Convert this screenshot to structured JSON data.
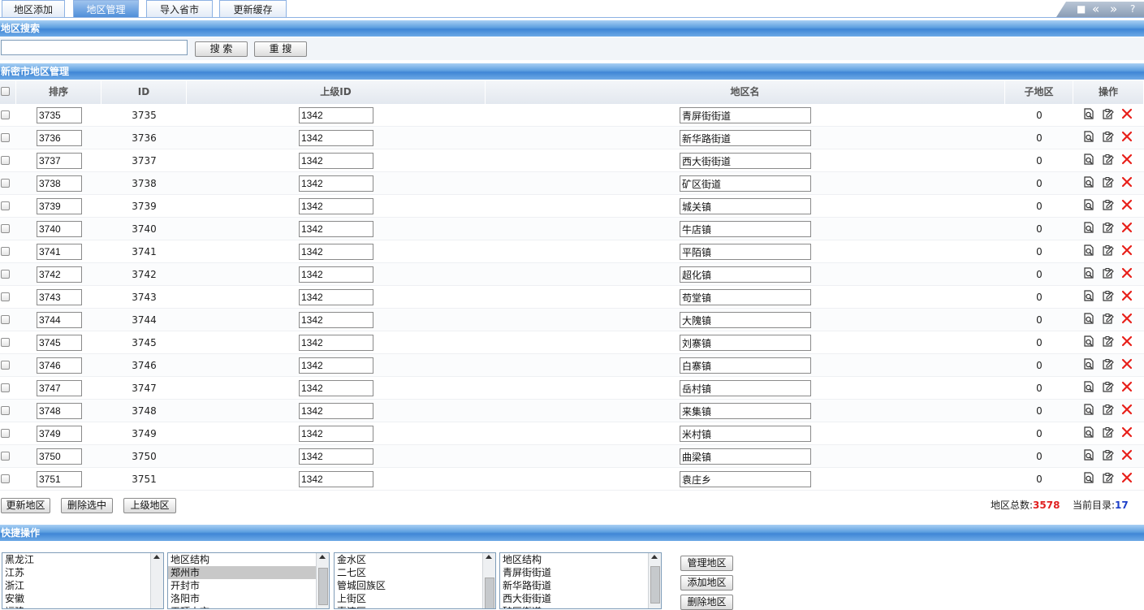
{
  "tabs": [
    {
      "label": "地区添加",
      "active": false
    },
    {
      "label": "地区管理",
      "active": true
    },
    {
      "label": "导入省市",
      "active": false
    },
    {
      "label": "更新缓存",
      "active": false
    }
  ],
  "top_controls": {
    "icons": [
      "sidebar-toggle-icon",
      "double-left-icon",
      "double-right-icon",
      "help-icon"
    ],
    "labels": [
      "■",
      "«",
      "»",
      "?"
    ]
  },
  "search": {
    "header": "地区搜索",
    "input_value": "",
    "search_label": "搜 索",
    "reset_label": "重 搜"
  },
  "manage": {
    "header": "新密市地区管理",
    "columns": {
      "order": "排序",
      "id": "ID",
      "parent_id": "上级ID",
      "name": "地区名",
      "children": "子地区",
      "actions": "操作"
    },
    "rows": [
      {
        "order": "3735",
        "id": "3735",
        "parent": "1342",
        "name": "青屏街街道",
        "children": "0"
      },
      {
        "order": "3736",
        "id": "3736",
        "parent": "1342",
        "name": "新华路街道",
        "children": "0"
      },
      {
        "order": "3737",
        "id": "3737",
        "parent": "1342",
        "name": "西大街街道",
        "children": "0"
      },
      {
        "order": "3738",
        "id": "3738",
        "parent": "1342",
        "name": "矿区街道",
        "children": "0"
      },
      {
        "order": "3739",
        "id": "3739",
        "parent": "1342",
        "name": "城关镇",
        "children": "0"
      },
      {
        "order": "3740",
        "id": "3740",
        "parent": "1342",
        "name": "牛店镇",
        "children": "0"
      },
      {
        "order": "3741",
        "id": "3741",
        "parent": "1342",
        "name": "平陌镇",
        "children": "0"
      },
      {
        "order": "3742",
        "id": "3742",
        "parent": "1342",
        "name": "超化镇",
        "children": "0"
      },
      {
        "order": "3743",
        "id": "3743",
        "parent": "1342",
        "name": "苟堂镇",
        "children": "0"
      },
      {
        "order": "3744",
        "id": "3744",
        "parent": "1342",
        "name": "大隗镇",
        "children": "0"
      },
      {
        "order": "3745",
        "id": "3745",
        "parent": "1342",
        "name": "刘寨镇",
        "children": "0"
      },
      {
        "order": "3746",
        "id": "3746",
        "parent": "1342",
        "name": "白寨镇",
        "children": "0"
      },
      {
        "order": "3747",
        "id": "3747",
        "parent": "1342",
        "name": "岳村镇",
        "children": "0"
      },
      {
        "order": "3748",
        "id": "3748",
        "parent": "1342",
        "name": "来集镇",
        "children": "0"
      },
      {
        "order": "3749",
        "id": "3749",
        "parent": "1342",
        "name": "米村镇",
        "children": "0"
      },
      {
        "order": "3750",
        "id": "3750",
        "parent": "1342",
        "name": "曲梁镇",
        "children": "0"
      },
      {
        "order": "3751",
        "id": "3751",
        "parent": "1342",
        "name": "袁庄乡",
        "children": "0"
      }
    ],
    "buttons": {
      "update": "更新地区",
      "delete_selected": "删除选中",
      "parent": "上级地区"
    },
    "stats": {
      "total_label": "地区总数:",
      "total_value": "3578",
      "current_label": "当前目录:",
      "current_value": "17"
    }
  },
  "quick": {
    "header": "快捷操作",
    "lists": [
      {
        "items": [
          "黑龙江",
          "江苏",
          "浙江",
          "安徽",
          "福建"
        ],
        "selected": -1
      },
      {
        "items": [
          "地区结构",
          "郑州市",
          "开封市",
          "洛阳市",
          "平顶山市"
        ],
        "selected": 1
      },
      {
        "items": [
          "金水区",
          "二七区",
          "管城回族区",
          "上街区",
          "惠济区"
        ],
        "selected": -1
      },
      {
        "items": [
          "地区结构",
          "青屏街街道",
          "新华路街道",
          "西大街街道",
          "矿区街道"
        ],
        "selected": -1
      }
    ],
    "buttons": {
      "manage": "管理地区",
      "add": "添加地区",
      "delete": "删除地区"
    }
  }
}
